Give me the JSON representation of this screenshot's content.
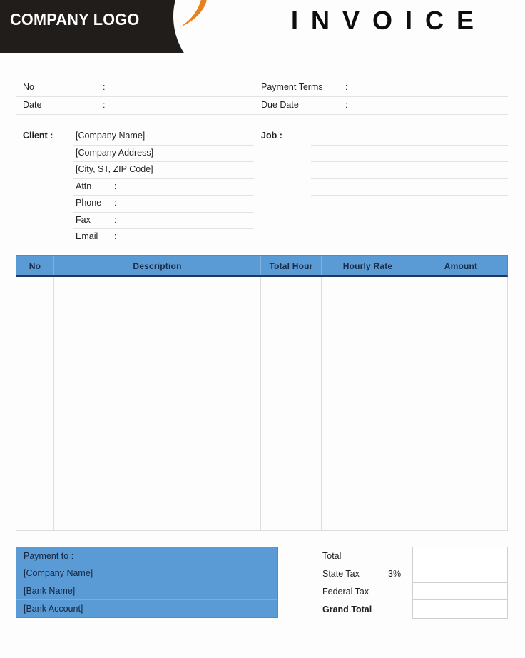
{
  "header": {
    "logo_text": "COMPANY LOGO",
    "logo_mark": "orange-swoosh-icon",
    "title": "INVOICE",
    "dark_color": "#211d1a",
    "accent_color": "#e8801c"
  },
  "info": {
    "rows": [
      {
        "label": "No",
        "colon": ":",
        "value": "",
        "label2": "Payment  Terms",
        "colon2": ":",
        "value2": ""
      },
      {
        "label": "Date",
        "colon": ":",
        "value": "",
        "label2": "Due Date",
        "colon2": ":",
        "value2": ""
      }
    ],
    "no_label": "No",
    "no_colon": ":",
    "date_label": "Date",
    "date_colon": ":",
    "payment_terms_label": "Payment  Terms",
    "payment_terms_colon": ":",
    "due_date_label": "Due Date",
    "due_date_colon": ":"
  },
  "client": {
    "label": "Client  :",
    "rows": [
      {
        "type": "value",
        "text": "[Company Name]"
      },
      {
        "type": "value",
        "text": "[Company Address]"
      },
      {
        "type": "value",
        "text": "[City, ST, ZIP Code]"
      },
      {
        "type": "field",
        "text": "Attn",
        "colon": ":"
      },
      {
        "type": "field",
        "text": "Phone",
        "colon": ":"
      },
      {
        "type": "field",
        "text": "Fax",
        "colon": ":"
      },
      {
        "type": "field",
        "text": "Email",
        "colon": ":"
      }
    ]
  },
  "job": {
    "label": "Job  :",
    "line_count": 4
  },
  "items": {
    "columns": [
      {
        "key": "no",
        "label": "No"
      },
      {
        "key": "description",
        "label": "Description"
      },
      {
        "key": "total_hour",
        "label": "Total Hour"
      },
      {
        "key": "hourly_rate",
        "label": "Hourly Rate"
      },
      {
        "key": "amount",
        "label": "Amount"
      }
    ],
    "rows": [],
    "header_color": "#5b9bd5",
    "header_rule_color": "#1f3864"
  },
  "payment": {
    "title": "Payment to :",
    "lines": [
      "[Company Name]",
      "[Bank Name]",
      "[Bank Account]"
    ],
    "background_color": "#5b9bd5"
  },
  "totals": {
    "rows": [
      {
        "label": "Total",
        "rate": "",
        "value": "",
        "bold": false
      },
      {
        "label": "State Tax",
        "rate": "3%",
        "value": "",
        "bold": false
      },
      {
        "label": "Federal Tax",
        "rate": "",
        "value": "",
        "bold": false
      },
      {
        "label": "Grand Total",
        "rate": "",
        "value": "",
        "bold": true
      }
    ]
  }
}
